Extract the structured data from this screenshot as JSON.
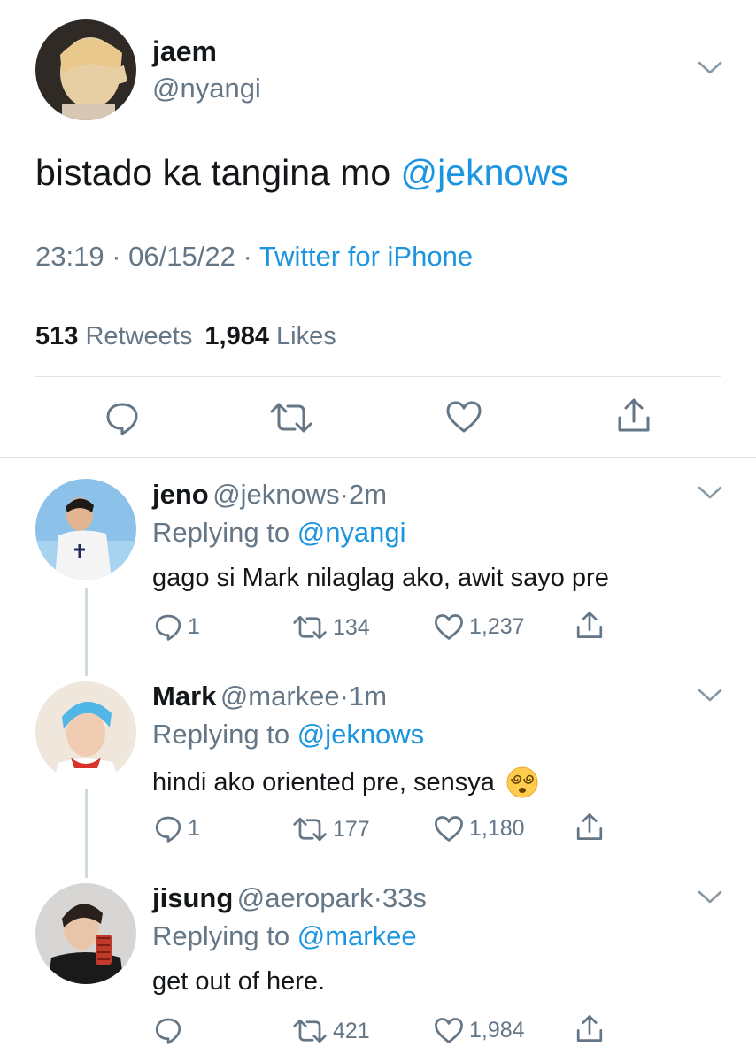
{
  "main_tweet": {
    "display_name": "jaem",
    "handle": "@nyangi",
    "text": "bistado ka tangina mo ",
    "mention": "@jeknows",
    "time": "23:19",
    "sep1": "·",
    "date": "06/15/22",
    "sep2": "·",
    "source": "Twitter for iPhone",
    "retweets_count": "513",
    "retweets_label": "Retweets",
    "likes_count": "1,984",
    "likes_label": "Likes",
    "actions": [
      "reply-icon",
      "retweet-icon",
      "like-icon",
      "share-icon"
    ]
  },
  "replies": [
    {
      "display_name": "jeno",
      "handle": "@jeknows",
      "dot": "·",
      "time": "2m",
      "replying_label": "Replying to ",
      "replying_to": "@nyangi",
      "text": "gago si Mark nilaglag ako, awit sayo pre",
      "reply_count": "1",
      "retweet_count": "134",
      "like_count": "1,237"
    },
    {
      "display_name": "Mark",
      "handle": "@markee",
      "dot": "·",
      "time": "1m",
      "replying_label": "Replying to ",
      "replying_to": "@jeknows",
      "text": "hindi ako oriented pre, sensya",
      "emoji": "dizzy-face-emoji",
      "reply_count": "1",
      "retweet_count": "177",
      "like_count": "1,180"
    },
    {
      "display_name": "jisung",
      "handle": "@aeropark",
      "dot": "·",
      "time": "33s",
      "replying_label": "Replying to ",
      "replying_to": "@markee",
      "text": "get out of here.",
      "reply_count": "",
      "retweet_count": "421",
      "like_count": "1,984"
    }
  ],
  "colors": {
    "link": "#1b95e0",
    "secondary": "#657786",
    "divider": "#dfe3e7"
  }
}
